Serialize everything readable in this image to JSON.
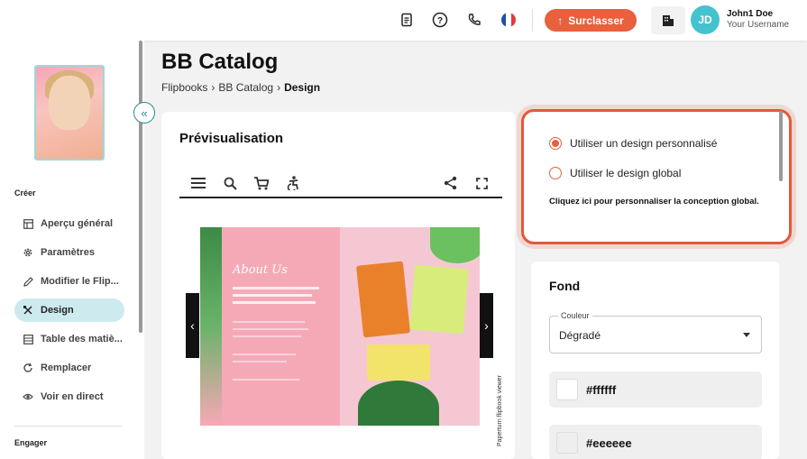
{
  "topbar": {
    "icons": [
      "document-icon",
      "help-icon",
      "phone-icon",
      "flag-fr-icon"
    ],
    "upgrade_label": "Surclasser",
    "user": {
      "initials": "JD",
      "name": "John1 Doe",
      "username": "Your Username"
    }
  },
  "sidebar": {
    "section_create": "Créer",
    "items": [
      {
        "label": "Aperçu général",
        "icon": "layout-icon"
      },
      {
        "label": "Paramètres",
        "icon": "gear-icon"
      },
      {
        "label": "Modifier le Flip...",
        "icon": "pencil-icon"
      },
      {
        "label": "Design",
        "icon": "design-tools-icon",
        "active": true
      },
      {
        "label": "Table des matiè...",
        "icon": "table-icon"
      },
      {
        "label": "Remplacer",
        "icon": "refresh-icon"
      },
      {
        "label": "Voir en direct",
        "icon": "eye-icon"
      }
    ],
    "section_engage": "Engager"
  },
  "page": {
    "title": "BB Catalog",
    "breadcrumb": [
      "Flipbooks",
      "BB Catalog",
      "Design"
    ]
  },
  "preview": {
    "title": "Prévisualisation",
    "viewer_label": "Paperturn flipbook viewer",
    "book_heading": "About Us"
  },
  "design": {
    "option_custom": "Utiliser un design personnalisé",
    "option_global": "Utiliser le design global",
    "selected": "custom",
    "hint": "Cliquez ici pour personnaliser la conception global."
  },
  "fond": {
    "title": "Fond",
    "select_label": "Couleur",
    "select_value": "Dégradé",
    "colors": [
      "#ffffff",
      "#eeeeee"
    ]
  },
  "colors": {
    "accent": "#e8603c",
    "active_nav": "#cdebee",
    "teal": "#45c2cf"
  }
}
